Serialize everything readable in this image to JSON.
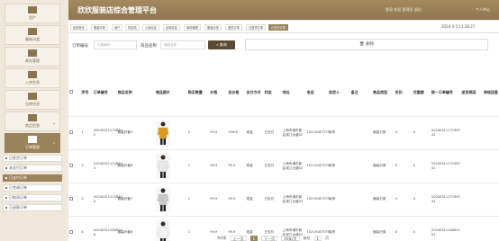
{
  "app": {
    "title": "欣欣服装店综合管理平台",
    "user_info": "登录 欢迎 管理员 退出",
    "personal_center": "个人中心"
  },
  "sidebar": {
    "items": [
      {
        "label": "用户",
        "icon": "flag-icon"
      },
      {
        "label": "服装分类",
        "icon": "shirt-icon"
      },
      {
        "label": "库存管理",
        "icon": "box-icon"
      },
      {
        "label": "入库信息",
        "icon": "bar-chart-icon"
      },
      {
        "label": "出库信息",
        "icon": "grid-icon"
      },
      {
        "label": "商品信息",
        "icon": "list-icon"
      },
      {
        "label": "订单管理",
        "icon": "order-icon"
      }
    ],
    "sub_items": [
      "已发货订单",
      "未支付订单",
      "已支付订单",
      "已完成订单",
      "已取消订单",
      "已退款订单"
    ],
    "selected_sub": 2
  },
  "tabs": [
    "系统首页",
    "服装分类",
    "用户",
    "供应商",
    "入库信息",
    "出库信息",
    "库存管理",
    "服装分类",
    "退货订单",
    "已退货订单",
    "已支付订单"
  ],
  "active_tab": 10,
  "datetime": "2024-3-5 11:28:27",
  "search": {
    "order_no_label": "订单编号",
    "order_no_placeholder": "订单编号",
    "product_name_label": "商品名称",
    "product_name_placeholder": "商品名称",
    "search_button": "查询",
    "delete_button": "删除"
  },
  "table": {
    "headers": [
      "序号",
      "订单编号",
      "商品名称",
      "商品图片",
      "购买数量",
      "价格",
      "总价格",
      "支付方式",
      "状态",
      "地址",
      "电话",
      "收货人",
      "备注",
      "商品类型",
      "折扣",
      "优惠额",
      "统一订单编号",
      "退货原因",
      "审核回复"
    ],
    "rows": [
      {
        "no": "1",
        "order_no": "20240311172840 2",
        "product": "服装外套5",
        "qty": "2",
        "price": "99.9",
        "total": "199.8",
        "pay": "现金",
        "status": "已支付",
        "address": "上海市浦东新区滨江大道02",
        "phone": "15219187575",
        "receiver": "晓萍",
        "remark": "",
        "category": "服装分类",
        "discount": "0",
        "offer": "0",
        "unified_no": "20240311171987 41",
        "reason": "",
        "reply": "",
        "shirt_color": "#d99a1e"
      },
      {
        "no": "2",
        "order_no": "20240311172840 3",
        "product": "服装外套6",
        "qty": "1",
        "price": "99.9",
        "total": "99.9",
        "pay": "现金",
        "status": "已支付",
        "address": "上海市浦东新区滨江大道02",
        "phone": "15219187575",
        "receiver": "晓萍",
        "remark": "",
        "category": "服装分类",
        "discount": "0",
        "offer": "0",
        "unified_no": "20240311171987 41",
        "reason": "",
        "reply": "",
        "shirt_color": "#e8e8e8"
      },
      {
        "no": "3",
        "order_no": "20240311172840 0",
        "product": "服装外套7",
        "qty": "1",
        "price": "99.9",
        "total": "99.9",
        "pay": "现金",
        "status": "已支付",
        "address": "上海市浦东新区滨江大道02",
        "phone": "15219187575",
        "receiver": "晓萍",
        "remark": "",
        "category": "服装分类",
        "discount": "0",
        "offer": "0",
        "unified_no": "20240311171987 41",
        "reason": "",
        "reply": "",
        "shirt_color": "#c7c7c7"
      },
      {
        "no": "4",
        "order_no": "20240311164974 6",
        "product": "服装外套8",
        "qty": "1",
        "price": "99.9",
        "total": "99.9",
        "pay": "现金",
        "status": "已支付",
        "address": "上海市浦东新区滨江大道02",
        "phone": "15219187575",
        "receiver": "晓萍",
        "remark": "",
        "category": "服装分类",
        "discount": "0",
        "offer": "0",
        "unified_no": "20240311164921 91",
        "reason": "",
        "reply": "",
        "shirt_color": "#f2f2f2"
      }
    ]
  },
  "pager": {
    "total": "共4条",
    "prev": "上一页",
    "current": "1",
    "next": "下一页",
    "per_page": "10条/页",
    "goto": "前往",
    "goto_page": "1",
    "page_unit": "页"
  },
  "colors": {
    "accent": "#9a825a",
    "dark": "#5a4a32"
  }
}
